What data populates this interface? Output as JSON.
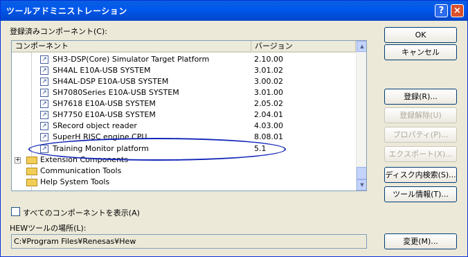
{
  "window": {
    "title": "ツールアドミニストレーション",
    "help_btn": "?",
    "close_btn": "×"
  },
  "list_label": "登録済みコンポーネント(C):",
  "columns": {
    "component": "コンポーネント",
    "version": "バージョン"
  },
  "rows": [
    {
      "name": "SH3-DSP(Core) Simulator Target Platform",
      "version": "2.10.00"
    },
    {
      "name": "SH4AL E10A-USB SYSTEM",
      "version": "3.01.02"
    },
    {
      "name": "SH4AL-DSP E10A-USB SYSTEM",
      "version": "3.00.02"
    },
    {
      "name": "SH7080Series E10A-USB SYSTEM",
      "version": "3.01.00"
    },
    {
      "name": "SH7618 E10A-USB SYSTEM",
      "version": "2.05.02"
    },
    {
      "name": "SH7750 E10A-USB SYSTEM",
      "version": "2.04.01"
    },
    {
      "name": "SRecord object reader",
      "version": "4.03.00"
    },
    {
      "name": "SuperH RISC engine CPU",
      "version": "8.08.01"
    },
    {
      "name": "Training Monitor platform",
      "version": "5.1"
    }
  ],
  "folders": [
    {
      "name": "Extension Components",
      "expand": "+"
    },
    {
      "name": "Communication Tools",
      "expand": ""
    },
    {
      "name": "Help System Tools",
      "expand": ""
    }
  ],
  "buttons": {
    "ok": "OK",
    "cancel": "キャンセル",
    "register": "登録(R)...",
    "unregister": "登録解除(U)",
    "properties": "プロパティ(P)...",
    "export": "エクスポート(X)...",
    "disk_search": "ディスク内検索(S)...",
    "tool_info": "ツール情報(T)...",
    "change": "変更(M)..."
  },
  "show_all_label": "すべてのコンポーネントを表示(A)",
  "hew_location_label": "HEWツールの場所(L):",
  "hew_path": "C:¥Program Files¥Renesas¥Hew",
  "scrollbar": {
    "up": "▲",
    "down": "▼"
  }
}
